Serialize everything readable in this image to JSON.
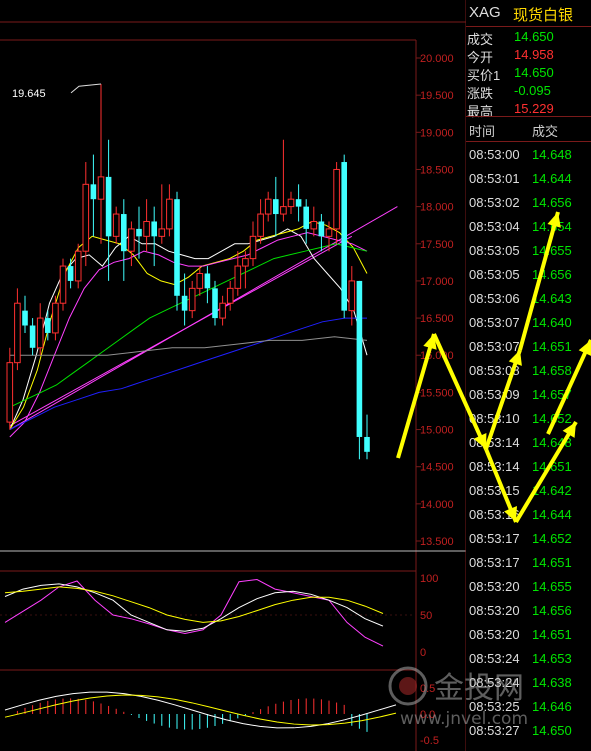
{
  "header": {
    "symbol": "XAG",
    "name": "现货白银"
  },
  "quote": [
    {
      "key": "成交",
      "value": "14.650",
      "color": "#00e600"
    },
    {
      "key": "今开",
      "value": "14.958",
      "color": "#ff3030"
    },
    {
      "key": "买价1",
      "value": "14.650",
      "color": "#00e600"
    },
    {
      "key": "涨跌",
      "value": "-0.095",
      "color": "#00e600"
    },
    {
      "key": "最高",
      "value": "15.229",
      "color": "#ff3030"
    }
  ],
  "ticks_header": {
    "time": "时间",
    "deal": "成交"
  },
  "ticks": [
    {
      "time": "08:53:00",
      "price": "14.648"
    },
    {
      "time": "08:53:01",
      "price": "14.644"
    },
    {
      "time": "08:53:02",
      "price": "14.656"
    },
    {
      "time": "08:53:04",
      "price": "14.654"
    },
    {
      "time": "08:53:05",
      "price": "14.655"
    },
    {
      "time": "08:53:05",
      "price": "14.656"
    },
    {
      "time": "08:53:06",
      "price": "14.643"
    },
    {
      "time": "08:53:07",
      "price": "14.640"
    },
    {
      "time": "08:53:07",
      "price": "14.651"
    },
    {
      "time": "08:53:08",
      "price": "14.658"
    },
    {
      "time": "08:53:09",
      "price": "14.657"
    },
    {
      "time": "08:53:10",
      "price": "14.652"
    },
    {
      "time": "08:53:14",
      "price": "14.648"
    },
    {
      "time": "08:53:14",
      "price": "14.651"
    },
    {
      "time": "08:53:15",
      "price": "14.642"
    },
    {
      "time": "08:53:16",
      "price": "14.644"
    },
    {
      "time": "08:53:17",
      "price": "14.652"
    },
    {
      "time": "08:53:17",
      "price": "14.651"
    },
    {
      "time": "08:53:20",
      "price": "14.655"
    },
    {
      "time": "08:53:20",
      "price": "14.656"
    },
    {
      "time": "08:53:20",
      "price": "14.651"
    },
    {
      "time": "08:53:24",
      "price": "14.653"
    },
    {
      "time": "08:53:24",
      "price": "14.638"
    },
    {
      "time": "08:53:25",
      "price": "14.646"
    },
    {
      "time": "08:53:27",
      "price": "14.650"
    }
  ],
  "colors": {
    "up": "#ff3030",
    "down": "#40ffff",
    "grid": "#7a1a1a",
    "arrow": "#ffff00"
  },
  "watermark": {
    "brand": "金投网",
    "url": "www.jnvel.com"
  },
  "chart_data": {
    "type": "candlestick",
    "price_axis": {
      "ylim": [
        13.5,
        20.0
      ],
      "tick_labels": [
        "20.000",
        "19.500",
        "19.000",
        "18.500",
        "18.000",
        "17.500",
        "17.000",
        "16.500",
        "16.000",
        "15.500",
        "15.000",
        "14.500",
        "14.000",
        "13.500"
      ]
    },
    "high_annotation": "19.645",
    "candles": [
      [
        15.1,
        15.9,
        15.0,
        16.1
      ],
      [
        15.9,
        16.7,
        15.8,
        16.9
      ],
      [
        16.6,
        16.4,
        16.3,
        16.8
      ],
      [
        16.4,
        16.1,
        16.0,
        16.5
      ],
      [
        16.1,
        16.5,
        16.0,
        16.7
      ],
      [
        16.5,
        16.3,
        16.2,
        16.6
      ],
      [
        16.3,
        16.7,
        16.2,
        16.8
      ],
      [
        16.7,
        17.2,
        16.6,
        17.3
      ],
      [
        17.2,
        17.0,
        16.9,
        17.3
      ],
      [
        17.0,
        17.4,
        16.9,
        17.5
      ],
      [
        17.4,
        18.3,
        17.2,
        18.6
      ],
      [
        18.3,
        18.1,
        17.6,
        18.7
      ],
      [
        18.1,
        18.4,
        17.5,
        19.65
      ],
      [
        18.4,
        17.6,
        17.0,
        18.9
      ],
      [
        17.6,
        17.9,
        17.5,
        18.0
      ],
      [
        17.9,
        17.4,
        17.0,
        18.1
      ],
      [
        17.4,
        17.7,
        17.2,
        17.8
      ],
      [
        17.7,
        17.6,
        17.3,
        18.0
      ],
      [
        17.6,
        17.8,
        17.4,
        18.1
      ],
      [
        17.8,
        17.6,
        17.2,
        18.0
      ],
      [
        17.6,
        17.7,
        17.5,
        18.3
      ],
      [
        17.7,
        18.1,
        17.6,
        18.3
      ],
      [
        18.1,
        16.8,
        16.6,
        18.2
      ],
      [
        16.8,
        16.6,
        16.4,
        17.1
      ],
      [
        16.6,
        16.9,
        16.5,
        17.0
      ],
      [
        16.9,
        17.1,
        16.8,
        17.2
      ],
      [
        17.1,
        16.9,
        16.7,
        17.2
      ],
      [
        16.9,
        16.5,
        16.4,
        17.0
      ],
      [
        16.5,
        16.7,
        16.4,
        16.8
      ],
      [
        16.7,
        16.9,
        16.6,
        17.0
      ],
      [
        16.9,
        17.2,
        16.8,
        17.4
      ],
      [
        17.2,
        17.3,
        16.9,
        17.4
      ],
      [
        17.3,
        17.6,
        17.2,
        17.8
      ],
      [
        17.6,
        17.9,
        17.5,
        18.1
      ],
      [
        17.9,
        18.1,
        17.8,
        18.2
      ],
      [
        18.1,
        17.9,
        17.6,
        18.4
      ],
      [
        17.9,
        18.0,
        17.8,
        18.9
      ],
      [
        18.0,
        18.1,
        17.9,
        18.2
      ],
      [
        18.1,
        18.0,
        17.8,
        18.3
      ],
      [
        18.0,
        17.7,
        17.5,
        18.1
      ],
      [
        17.7,
        17.8,
        17.6,
        18.0
      ],
      [
        17.8,
        17.6,
        17.4,
        17.9
      ],
      [
        17.6,
        17.7,
        17.4,
        17.8
      ],
      [
        17.7,
        18.5,
        17.5,
        18.6
      ],
      [
        18.6,
        16.6,
        16.5,
        18.7
      ],
      [
        16.6,
        17.0,
        16.4,
        17.2
      ],
      [
        17.0,
        14.9,
        14.6,
        17.0
      ],
      [
        14.9,
        14.7,
        14.6,
        15.2
      ]
    ],
    "ma_lines": [
      {
        "color": "#ffffff",
        "values": [
          15.0,
          15.4,
          16.0,
          16.7,
          17.1,
          17.3,
          17.35,
          17.2,
          17.45,
          17.6,
          17.5,
          17.5,
          17.4,
          17.35,
          17.3,
          17.3,
          17.4,
          17.5,
          17.5,
          17.55,
          17.6,
          17.7,
          17.6,
          17.3,
          17.1,
          16.9,
          16.6,
          16.0
        ]
      },
      {
        "color": "#ffff00",
        "values": [
          15.0,
          15.3,
          15.8,
          16.5,
          17.1,
          17.45,
          17.6,
          17.55,
          17.5,
          17.35,
          17.1,
          17.0,
          16.95,
          17.05,
          17.2,
          17.25,
          17.3,
          17.4,
          17.55,
          17.6,
          17.65,
          17.7,
          17.8,
          17.75,
          17.65,
          17.45,
          17.1
        ]
      },
      {
        "color": "#ff40ff",
        "values": [
          14.9,
          15.1,
          15.5,
          16.0,
          16.5,
          16.9,
          17.15,
          17.25,
          17.3,
          17.4,
          17.35,
          17.25,
          17.2,
          17.2,
          17.25,
          17.3,
          17.35,
          17.45,
          17.55,
          17.6,
          17.65,
          17.6,
          17.55,
          17.5,
          17.4
        ]
      },
      {
        "color": "#00e000",
        "values": [
          15.3,
          15.4,
          15.5,
          15.6,
          15.75,
          15.9,
          16.05,
          16.2,
          16.35,
          16.5,
          16.6,
          16.7,
          16.8,
          16.9,
          17.0,
          17.1,
          17.2,
          17.3,
          17.35,
          17.4,
          17.45,
          17.5,
          17.45,
          17.4
        ]
      },
      {
        "color": "#2020ff",
        "values": [
          15.0,
          15.15,
          15.3,
          15.4,
          15.5,
          15.55,
          15.65,
          15.75,
          15.85,
          15.95,
          16.05,
          16.15,
          16.25,
          16.35,
          16.45,
          16.5,
          16.5
        ]
      },
      {
        "color": "#909090",
        "values": [
          16.0,
          16.0,
          16.0,
          16.0,
          16.05,
          16.1,
          16.1,
          16.15,
          16.2,
          16.2,
          16.25,
          16.2
        ]
      }
    ],
    "trend_lines": [
      {
        "color": "#ff40ff",
        "from": [
          0,
          15.0
        ],
        "to": [
          51,
          18.0
        ]
      },
      {
        "color": "#ff40ff",
        "from": [
          0,
          15.05
        ],
        "to": [
          45,
          17.6
        ]
      }
    ],
    "oscillator_1": {
      "tick_labels": [
        "100",
        "50",
        "0"
      ],
      "ylim": [
        0,
        100
      ]
    },
    "oscillator_2": {
      "tick_labels": [
        "0.5",
        "0.0",
        "-0.5"
      ],
      "ylim": [
        -0.5,
        0.5
      ]
    }
  }
}
